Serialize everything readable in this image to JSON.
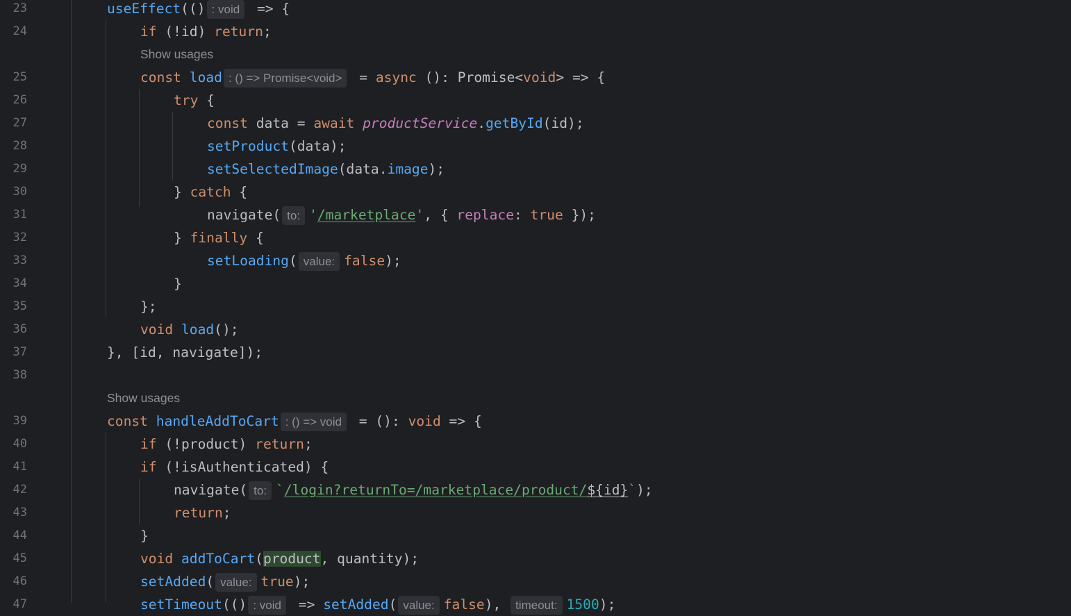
{
  "editor": {
    "usage_label": "Show usages",
    "lines": [
      {
        "num": "23",
        "tokens": [
          {
            "t": "useEffect",
            "c": "fn"
          },
          {
            "t": "(()"
          },
          {
            "t": ": void",
            "c": "hint"
          },
          {
            "t": " => {"
          }
        ]
      },
      {
        "num": "24",
        "tokens": [
          {
            "t": "if",
            "c": "kw"
          },
          {
            "t": " (!id) "
          },
          {
            "t": "return",
            "c": "kw"
          },
          {
            "t": ";"
          }
        ]
      },
      {
        "num": "25",
        "usage": true,
        "tokens": [
          {
            "t": "const",
            "c": "kw"
          },
          {
            "t": " "
          },
          {
            "t": "load",
            "c": "fn"
          },
          {
            "t": ": () => Promise<void>",
            "c": "hint"
          },
          {
            "t": " = "
          },
          {
            "t": "async",
            "c": "kw"
          },
          {
            "t": " (): Promise<"
          },
          {
            "t": "void",
            "c": "kw"
          },
          {
            "t": "> => {"
          }
        ]
      },
      {
        "num": "26",
        "tokens": [
          {
            "t": "try",
            "c": "kw"
          },
          {
            "t": " {"
          }
        ]
      },
      {
        "num": "27",
        "tokens": [
          {
            "t": "const",
            "c": "kw"
          },
          {
            "t": " data = "
          },
          {
            "t": "await",
            "c": "kw"
          },
          {
            "t": " "
          },
          {
            "t": "productService",
            "c": "it"
          },
          {
            "t": "."
          },
          {
            "t": "getById",
            "c": "fn"
          },
          {
            "t": "(id);"
          }
        ]
      },
      {
        "num": "28",
        "tokens": [
          {
            "t": "setProduct",
            "c": "fn"
          },
          {
            "t": "(data);"
          }
        ]
      },
      {
        "num": "29",
        "tokens": [
          {
            "t": "setSelectedImage",
            "c": "fn"
          },
          {
            "t": "(data."
          },
          {
            "t": "image",
            "c": "fn"
          },
          {
            "t": ");"
          }
        ]
      },
      {
        "num": "30",
        "tokens": [
          {
            "t": "} "
          },
          {
            "t": "catch",
            "c": "kw"
          },
          {
            "t": " {"
          }
        ]
      },
      {
        "num": "31",
        "tokens": [
          {
            "t": "navigate("
          },
          {
            "t": "to:",
            "c": "hint"
          },
          {
            "t": "'",
            "c": "str"
          },
          {
            "t": "/marketplace",
            "c": "str lnk"
          },
          {
            "t": "'",
            "c": "str"
          },
          {
            "t": ", { "
          },
          {
            "t": "replace",
            "c": "prop"
          },
          {
            "t": ": "
          },
          {
            "t": "true",
            "c": "kw"
          },
          {
            "t": " });"
          }
        ]
      },
      {
        "num": "32",
        "tokens": [
          {
            "t": "} "
          },
          {
            "t": "finally",
            "c": "kw"
          },
          {
            "t": " {"
          }
        ]
      },
      {
        "num": "33",
        "tokens": [
          {
            "t": "setLoading",
            "c": "fn"
          },
          {
            "t": "("
          },
          {
            "t": "value:",
            "c": "hint"
          },
          {
            "t": "false",
            "c": "kw"
          },
          {
            "t": ");"
          }
        ]
      },
      {
        "num": "34",
        "tokens": [
          {
            "t": "}"
          }
        ]
      },
      {
        "num": "35",
        "tokens": [
          {
            "t": "};"
          }
        ]
      },
      {
        "num": "36",
        "tokens": [
          {
            "t": "void",
            "c": "kw"
          },
          {
            "t": " "
          },
          {
            "t": "load",
            "c": "fn"
          },
          {
            "t": "();"
          }
        ]
      },
      {
        "num": "37",
        "tokens": [
          {
            "t": "}, [id, navigate]);"
          }
        ]
      },
      {
        "num": "38",
        "tokens": []
      },
      {
        "num": "39",
        "usage": true,
        "tokens": [
          {
            "t": "const",
            "c": "kw"
          },
          {
            "t": " "
          },
          {
            "t": "handleAddToCart",
            "c": "fn"
          },
          {
            "t": ": () => void",
            "c": "hint"
          },
          {
            "t": " = (): "
          },
          {
            "t": "void",
            "c": "kw"
          },
          {
            "t": " => {"
          }
        ]
      },
      {
        "num": "40",
        "tokens": [
          {
            "t": "if",
            "c": "kw"
          },
          {
            "t": " (!product) "
          },
          {
            "t": "return",
            "c": "kw"
          },
          {
            "t": ";"
          }
        ]
      },
      {
        "num": "41",
        "tokens": [
          {
            "t": "if",
            "c": "kw"
          },
          {
            "t": " (!isAuthenticated) {"
          }
        ]
      },
      {
        "num": "42",
        "tokens": [
          {
            "t": "navigate("
          },
          {
            "t": "to:",
            "c": "hint"
          },
          {
            "t": "`",
            "c": "str"
          },
          {
            "t": "/login?returnTo=/marketplace/product/",
            "c": "str lnk"
          },
          {
            "t": "${",
            "c": "lnk"
          },
          {
            "t": "id",
            "c": "lnk"
          },
          {
            "t": "}",
            "c": "lnk"
          },
          {
            "t": "`",
            "c": "str"
          },
          {
            "t": ");"
          }
        ]
      },
      {
        "num": "43",
        "tokens": [
          {
            "t": "return",
            "c": "kw"
          },
          {
            "t": ";"
          }
        ]
      },
      {
        "num": "44",
        "tokens": [
          {
            "t": "}"
          }
        ]
      },
      {
        "num": "45",
        "tokens": [
          {
            "t": "void",
            "c": "kw"
          },
          {
            "t": " "
          },
          {
            "t": "addToCart",
            "c": "fn"
          },
          {
            "t": "("
          },
          {
            "t": "product",
            "c": "hl"
          },
          {
            "t": ", quantity);"
          }
        ]
      },
      {
        "num": "46",
        "tokens": [
          {
            "t": "setAdded",
            "c": "fn"
          },
          {
            "t": "("
          },
          {
            "t": "value:",
            "c": "hint"
          },
          {
            "t": "true",
            "c": "kw"
          },
          {
            "t": ");"
          }
        ]
      },
      {
        "num": "47",
        "tokens": [
          {
            "t": "setTimeout",
            "c": "fn"
          },
          {
            "t": "(()"
          },
          {
            "t": ": void",
            "c": "hint"
          },
          {
            "t": " => "
          },
          {
            "t": "setAdded",
            "c": "fn"
          },
          {
            "t": "("
          },
          {
            "t": "value:",
            "c": "hint"
          },
          {
            "t": "false",
            "c": "kw"
          },
          {
            "t": "), "
          },
          {
            "t": "timeout:",
            "c": "hint"
          },
          {
            "t": "1500",
            "c": "num"
          },
          {
            "t": ");"
          }
        ]
      }
    ]
  }
}
